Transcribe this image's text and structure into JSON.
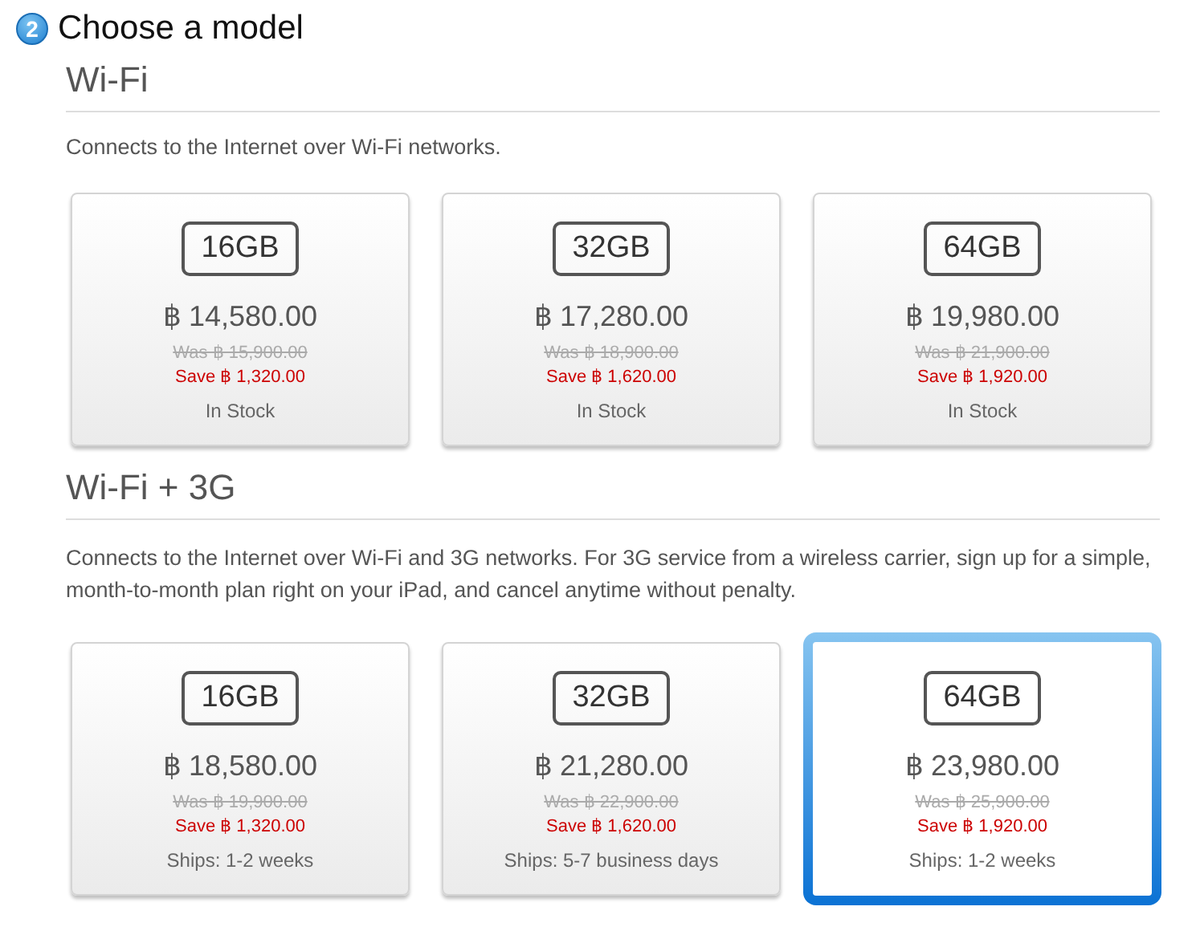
{
  "step": {
    "number": "2",
    "title": "Choose a model"
  },
  "sections": [
    {
      "title": "Wi-Fi",
      "description": "Connects to the Internet over Wi-Fi networks.",
      "models": [
        {
          "capacity": "16GB",
          "price": "฿ 14,580.00",
          "was": "Was ฿ 15,900.00",
          "save": "Save ฿ 1,320.00",
          "availability": "In Stock",
          "selected": false
        },
        {
          "capacity": "32GB",
          "price": "฿ 17,280.00",
          "was": "Was ฿ 18,900.00",
          "save": "Save ฿ 1,620.00",
          "availability": "In Stock",
          "selected": false
        },
        {
          "capacity": "64GB",
          "price": "฿ 19,980.00",
          "was": "Was ฿ 21,900.00",
          "save": "Save ฿ 1,920.00",
          "availability": "In Stock",
          "selected": false
        }
      ]
    },
    {
      "title": "Wi-Fi + 3G",
      "description": "Connects to the Internet over Wi-Fi and 3G networks. For 3G service from a wireless carrier, sign up for a simple, month-to-month plan right on your iPad, and cancel anytime without penalty.",
      "models": [
        {
          "capacity": "16GB",
          "price": "฿ 18,580.00",
          "was": "Was ฿ 19,900.00",
          "save": "Save ฿ 1,320.00",
          "availability": "Ships: 1-2 weeks",
          "selected": false
        },
        {
          "capacity": "32GB",
          "price": "฿ 21,280.00",
          "was": "Was ฿ 22,900.00",
          "save": "Save ฿ 1,620.00",
          "availability": "Ships: 5-7 business days",
          "selected": false
        },
        {
          "capacity": "64GB",
          "price": "฿ 23,980.00",
          "was": "Was ฿ 25,900.00",
          "save": "Save ฿ 1,920.00",
          "availability": "Ships: 1-2 weeks",
          "selected": true
        }
      ]
    }
  ]
}
